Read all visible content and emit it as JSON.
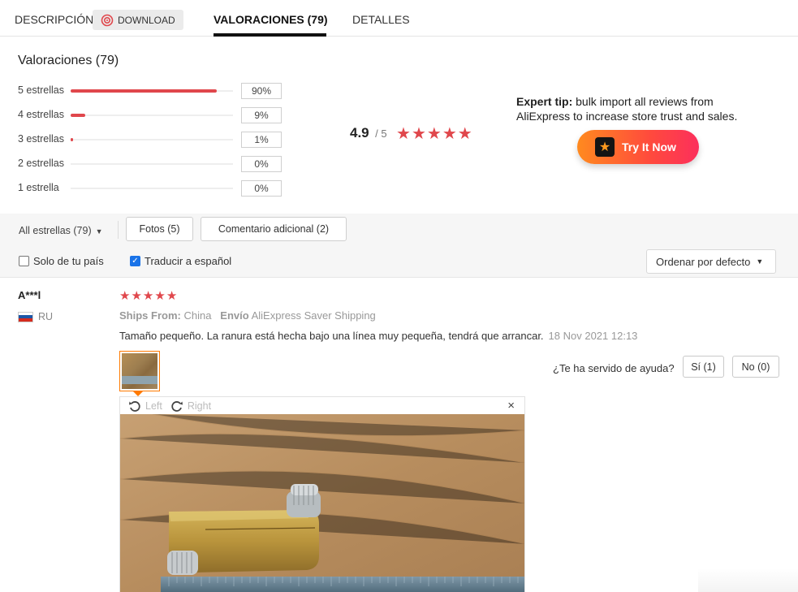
{
  "tabs": {
    "descripcion": "DESCRIPCIÓN",
    "download": "DOWNLOAD",
    "valoraciones": "VALORACIONES (79)",
    "detalles": "DETALLES"
  },
  "summary": {
    "title": "Valoraciones (79)",
    "distribution": [
      {
        "label": "5 estrellas",
        "pct_text": "90%",
        "fraction": 0.9
      },
      {
        "label": "4 estrellas",
        "pct_text": "9%",
        "fraction": 0.09
      },
      {
        "label": "3 estrellas",
        "pct_text": "1%",
        "fraction": 0.01
      },
      {
        "label": "2 estrellas",
        "pct_text": "0%",
        "fraction": 0.0
      },
      {
        "label": "1 estrella",
        "pct_text": "0%",
        "fraction": 0.0
      }
    ],
    "average": "4.9",
    "average_of": "/ 5",
    "stars": 5
  },
  "promo": {
    "tip_bold": "Expert tip:",
    "tip_text": " bulk import all reviews from AliExpress to increase store trust and sales.",
    "button_label": "Try It Now",
    "button_icon": "star-logo-icon"
  },
  "filters": {
    "all_stars": "All estrellas (79)",
    "fotos": "Fotos (5)",
    "comentario": "Comentario adicional (2)",
    "solo_pais": "Solo de tu país",
    "solo_pais_checked": false,
    "traducir": "Traducir a español",
    "traducir_checked": true,
    "ordenar": "Ordenar por defecto"
  },
  "review": {
    "user": "A***l",
    "country": "RU",
    "stars": 5,
    "ships_from_label": "Ships From:",
    "ships_from": "China",
    "envio_label": "Envío",
    "envio": "AliExpress Saver Shipping",
    "text": "Tamaño pequeño. La ranura está hecha bajo una línea muy pequeña, tendrá que arrancar.",
    "date": "18 Nov 2021 12:13",
    "helpful_question": "¿Te ha servido de ayuda?",
    "yes": "Sí (1)",
    "no": "No (0)",
    "viewer": {
      "rotate_left": "Left",
      "rotate_right": "Right",
      "close": "×"
    }
  },
  "colors": {
    "accent_red": "#e0474c",
    "tab_underline": "#111111",
    "thumb_border": "#ff7a00",
    "checkbox_blue": "#1a73e8",
    "try_gradient_start": "#ff8a1f",
    "try_gradient_end": "#fc2f5c"
  }
}
